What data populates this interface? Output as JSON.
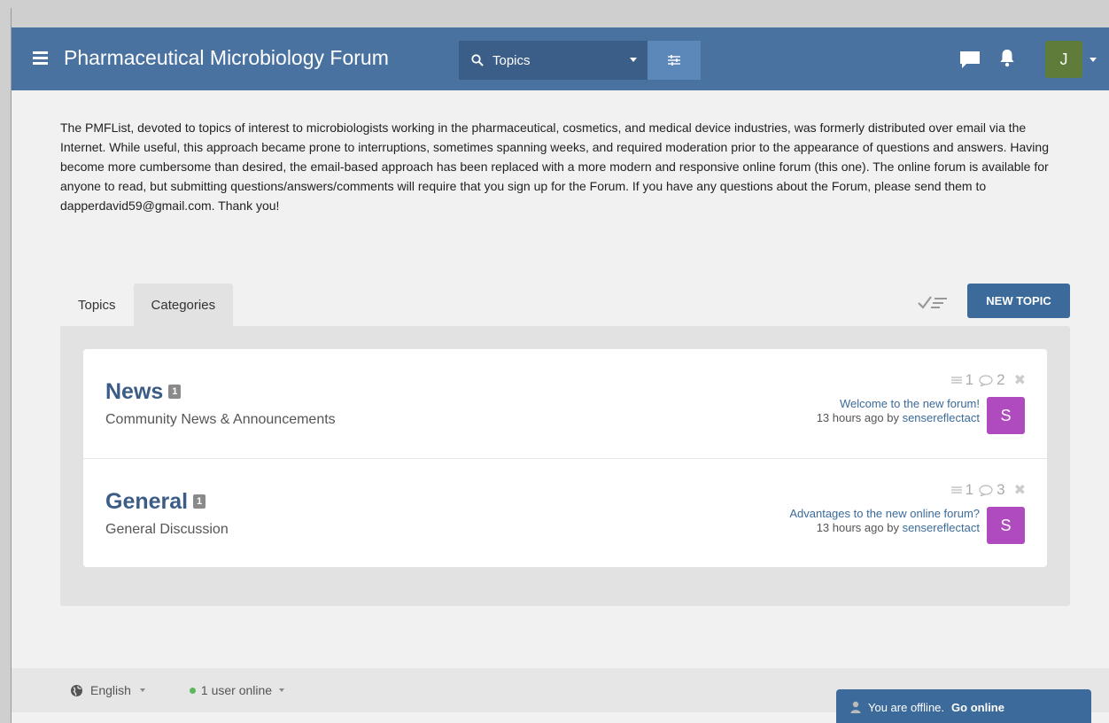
{
  "header": {
    "title": "Pharmaceutical Microbiology Forum",
    "search_scope": "Topics",
    "avatar_letter": "J",
    "avatar_color": "#5f7c3a",
    "brand_color": "#4a72a0"
  },
  "intro": {
    "text": "The PMFList, devoted to topics of interest to microbiologists working in the pharmaceutical, cosmetics, and medical device industries, was formerly distributed over email via the Internet. While useful, this approach became prone to interruptions, sometimes spanning weeks, and required moderation prior to the appearance of questions and answers. Having become more cumbersome than desired, the email-based approach has been replaced with a more modern and responsive online forum (this one). The online forum is available for anyone to read, but submitting questions/answers/comments will require that you sign up for the Forum. If you have any questions about the Forum, please send them to dapperdavid59@gmail.com. Thank you!"
  },
  "tabs": [
    {
      "label": "Topics",
      "active": false
    },
    {
      "label": "Categories",
      "active": true
    }
  ],
  "new_topic_label": "NEW TOPIC",
  "categories": [
    {
      "title": "News",
      "badge": "1",
      "description": "Community News & Announcements",
      "topics": "1",
      "posts": "2",
      "latest_title": "Welcome to the new forum!",
      "latest_time": "13 hours ago by",
      "latest_user": "sensereflectact",
      "avatar_letter": "S"
    },
    {
      "title": "General",
      "badge": "1",
      "description": "General Discussion",
      "topics": "1",
      "posts": "3",
      "latest_title": "Advantages to the new online forum?",
      "latest_time": "13 hours ago by",
      "latest_user": "sensereflectact",
      "avatar_letter": "S"
    }
  ],
  "footer": {
    "language": "English",
    "users_online": "1 user online"
  },
  "offline_bar": {
    "message": "You are offline.",
    "action": "Go online"
  },
  "icons": {
    "menu": "hamburger-icon",
    "search": "search-icon",
    "options": "sliders-icon",
    "chat": "chat-icon",
    "bell": "bell-icon",
    "globe": "globe-icon"
  }
}
